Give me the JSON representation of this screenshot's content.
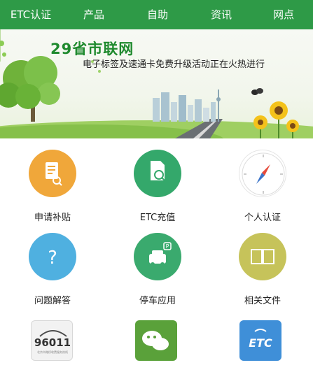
{
  "nav": {
    "items": [
      {
        "label": "ETC认证"
      },
      {
        "label": "产品"
      },
      {
        "label": "自助"
      },
      {
        "label": "资讯"
      },
      {
        "label": "网点"
      }
    ]
  },
  "banner": {
    "title": "29省市联网",
    "subtitle": "电子标签及速通卡免费升级活动正在火热进行"
  },
  "tiles": [
    {
      "label": "申请补贴",
      "icon": "document-search-icon",
      "color": "#f0a73a"
    },
    {
      "label": "ETC充值",
      "icon": "document-magnifier-icon",
      "color": "#34a86b"
    },
    {
      "label": "个人认证",
      "icon": "compass-icon",
      "color": "#e64b3b"
    },
    {
      "label": "问题解答",
      "icon": "question-icon",
      "color": "#4fb0e0"
    },
    {
      "label": "停车应用",
      "icon": "parking-car-icon",
      "color": "#3aaa6e"
    },
    {
      "label": "相关文件",
      "icon": "book-icon",
      "color": "#c6c35a"
    }
  ],
  "bottom_apps": [
    {
      "name": "96011",
      "icon": "hotline-96011-icon"
    },
    {
      "name": "wechat",
      "icon": "wechat-icon"
    },
    {
      "name": "ETC",
      "icon": "etc-app-icon"
    }
  ],
  "hotline": {
    "number": "96011",
    "caption": "北京市路桥收费服务热线"
  },
  "etc_badge": {
    "text": "ETC"
  }
}
